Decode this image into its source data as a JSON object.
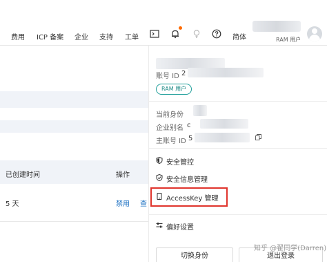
{
  "topnav": {
    "items": [
      "费用",
      "ICP 备案",
      "企业",
      "支持",
      "工单"
    ],
    "lang": "简体",
    "user_role": "RAM 用户",
    "icons": [
      "terminal-icon",
      "bell-icon",
      "lightbulb-icon",
      "help-icon"
    ]
  },
  "background": {
    "col_created": "已创建时间",
    "col_action": "操作",
    "row_days": "5 天",
    "row_disable": "禁用",
    "row_query": "查"
  },
  "panel": {
    "account_id_label": "账号 ID",
    "account_id_value": "2",
    "ram_tag": "RAM 用户",
    "current_identity_label": "当前身份",
    "enterprise_alias_label": "企业别名",
    "enterprise_alias_value": "c",
    "main_account_label": "主账号 ID",
    "main_account_value": "5",
    "menu": [
      {
        "label": "安全管控"
      },
      {
        "label": "安全信息管理"
      },
      {
        "label": "AccessKey 管理"
      },
      {
        "label": "偏好设置"
      }
    ],
    "switch_identity": "切换身份",
    "logout": "退出登录"
  },
  "watermark": "知乎 @翟同学(Darren)",
  "colors": {
    "accent": "#ff6a00",
    "teal": "#1f9f9a",
    "highlight_border": "#e0342c",
    "link": "#1a6fc2"
  }
}
